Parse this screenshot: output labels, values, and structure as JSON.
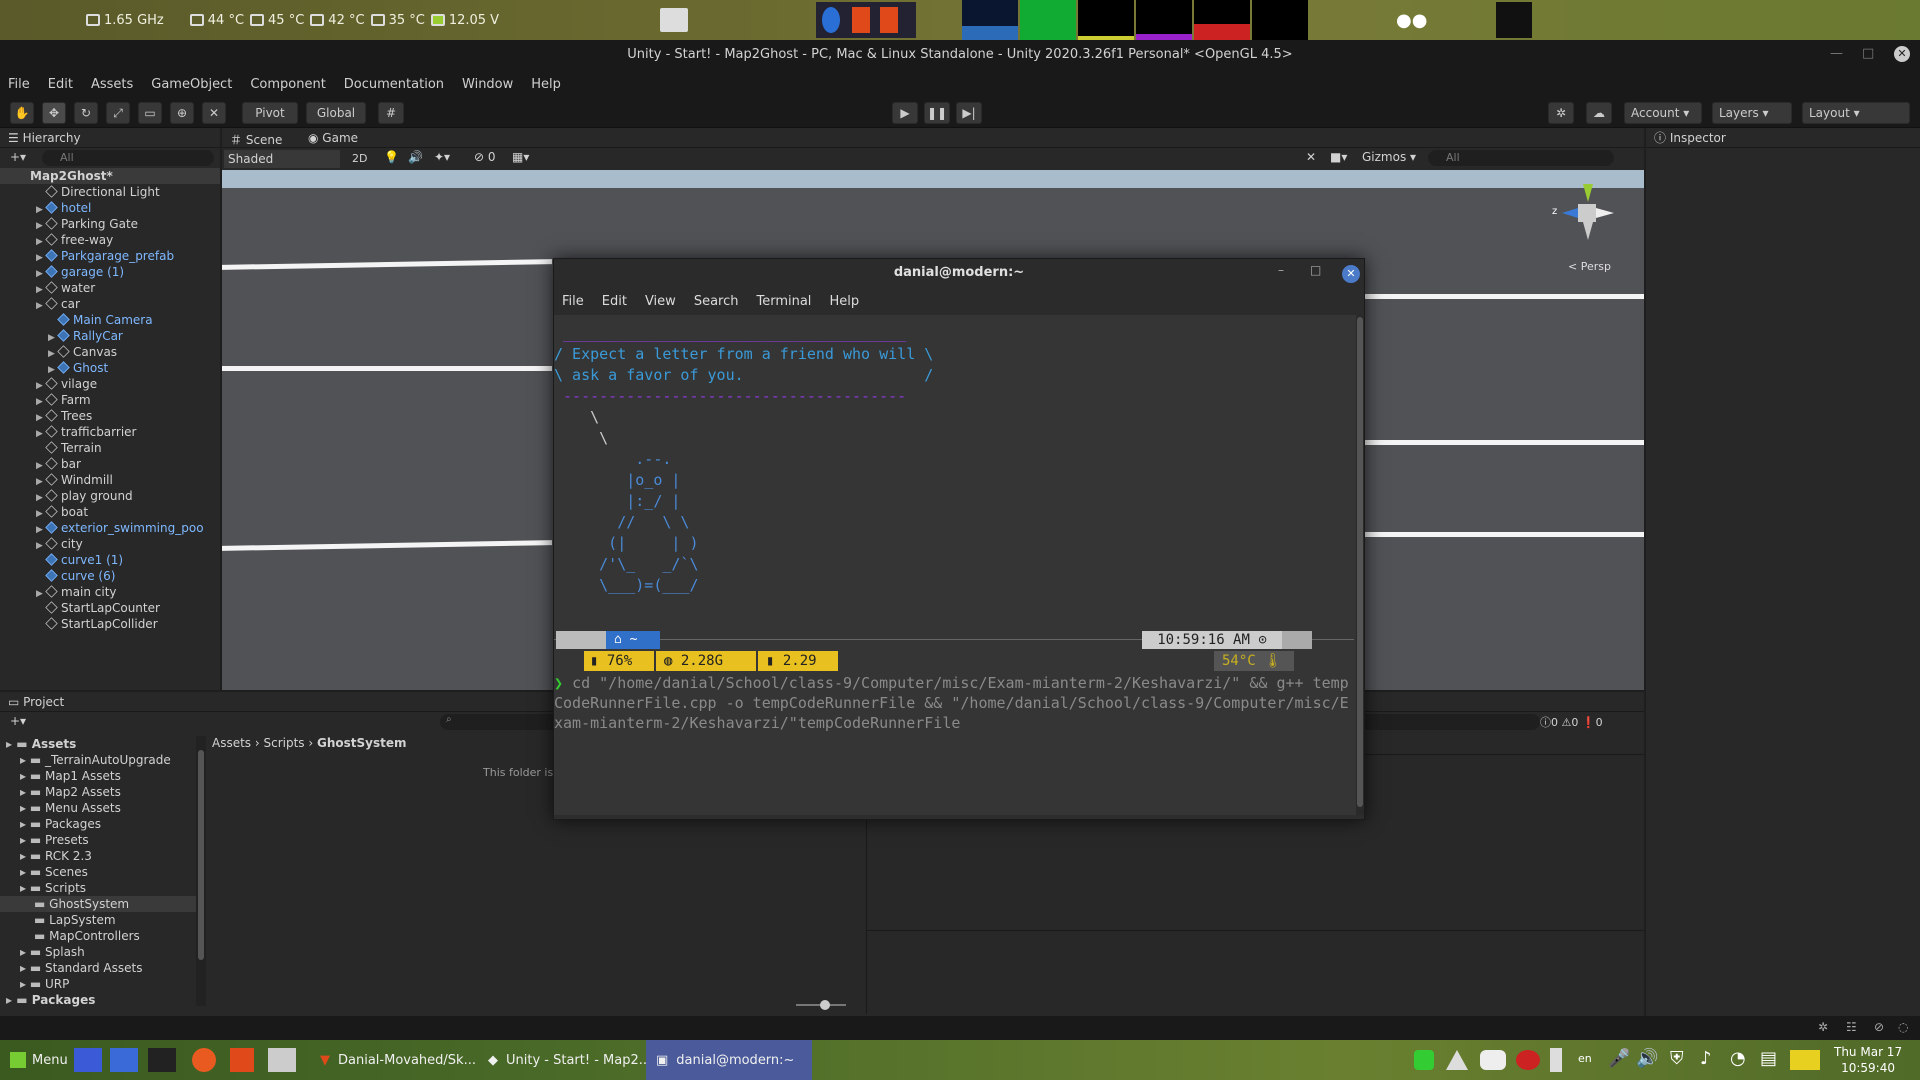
{
  "top_panel": {
    "cpu_freq": "1.65 GHz",
    "temps": [
      "44 °C",
      "45 °C",
      "42 °C",
      "35 °C"
    ],
    "voltage": "12.05 V"
  },
  "unity": {
    "title": "Unity - Start! - Map2Ghost - PC, Mac & Linux Standalone - Unity 2020.3.26f1 Personal* <OpenGL 4.5>",
    "menu": [
      "File",
      "Edit",
      "Assets",
      "GameObject",
      "Component",
      "Documentation",
      "Window",
      "Help"
    ],
    "toolbar": {
      "pivot": "Pivot",
      "global": "Global",
      "account": "Account",
      "layers": "Layers",
      "layout": "Layout"
    },
    "hierarchy": {
      "tab": "Hierarchy",
      "search_placeholder": "All",
      "scene": "Map2Ghost*",
      "items": [
        {
          "label": "Directional Light",
          "prefab": false,
          "indent": 1,
          "arrow": false
        },
        {
          "label": "hotel",
          "prefab": true,
          "indent": 1,
          "arrow": true
        },
        {
          "label": "Parking Gate",
          "prefab": false,
          "indent": 1,
          "arrow": true
        },
        {
          "label": "free-way",
          "prefab": false,
          "indent": 1,
          "arrow": true
        },
        {
          "label": "Parkgarage_prefab",
          "prefab": true,
          "indent": 1,
          "arrow": true
        },
        {
          "label": "garage (1)",
          "prefab": true,
          "indent": 1,
          "arrow": true
        },
        {
          "label": "water",
          "prefab": false,
          "indent": 1,
          "arrow": true
        },
        {
          "label": "car",
          "prefab": false,
          "indent": 1,
          "arrow": true
        },
        {
          "label": "Main Camera",
          "prefab": true,
          "indent": 2,
          "arrow": false
        },
        {
          "label": "RallyCar",
          "prefab": true,
          "indent": 2,
          "arrow": true
        },
        {
          "label": "Canvas",
          "prefab": false,
          "indent": 2,
          "arrow": true
        },
        {
          "label": "Ghost",
          "prefab": true,
          "indent": 2,
          "arrow": true
        },
        {
          "label": "vilage",
          "prefab": false,
          "indent": 1,
          "arrow": true
        },
        {
          "label": "Farm",
          "prefab": false,
          "indent": 1,
          "arrow": true
        },
        {
          "label": "Trees",
          "prefab": false,
          "indent": 1,
          "arrow": true
        },
        {
          "label": "trafficbarrier",
          "prefab": false,
          "indent": 1,
          "arrow": true
        },
        {
          "label": "Terrain",
          "prefab": false,
          "indent": 1,
          "arrow": false
        },
        {
          "label": "bar",
          "prefab": false,
          "indent": 1,
          "arrow": true
        },
        {
          "label": "Windmill",
          "prefab": false,
          "indent": 1,
          "arrow": true
        },
        {
          "label": "play ground",
          "prefab": false,
          "indent": 1,
          "arrow": true
        },
        {
          "label": "boat",
          "prefab": false,
          "indent": 1,
          "arrow": true
        },
        {
          "label": "exterior_swimming_poo",
          "prefab": true,
          "indent": 1,
          "arrow": true
        },
        {
          "label": "city",
          "prefab": false,
          "indent": 1,
          "arrow": true
        },
        {
          "label": "curve1 (1)",
          "prefab": true,
          "indent": 1,
          "arrow": false
        },
        {
          "label": "curve (6)",
          "prefab": true,
          "indent": 1,
          "arrow": false
        },
        {
          "label": "main city",
          "prefab": false,
          "indent": 1,
          "arrow": true
        },
        {
          "label": "StartLapCounter",
          "prefab": false,
          "indent": 1,
          "arrow": false
        },
        {
          "label": "StartLapCollider",
          "prefab": false,
          "indent": 1,
          "arrow": false
        }
      ]
    },
    "scene": {
      "tab_scene": "Scene",
      "tab_game": "Game",
      "shading": "Shaded",
      "mode_2d": "2D",
      "gizmos": "Gizmos",
      "search_placeholder": "All",
      "persp": "< Persp",
      "hidden_count": "0"
    },
    "inspector": {
      "tab": "Inspector"
    },
    "project": {
      "tab": "Project",
      "breadcrumb": [
        "Assets",
        "Scripts",
        "GhostSystem"
      ],
      "empty_msg": "This folder is",
      "counts": [
        "0",
        "0",
        "0"
      ],
      "tree": [
        {
          "label": "Assets",
          "indent": 0,
          "bold": true
        },
        {
          "label": "_TerrainAutoUpgrade",
          "indent": 1
        },
        {
          "label": "Map1 Assets",
          "indent": 1
        },
        {
          "label": "Map2 Assets",
          "indent": 1
        },
        {
          "label": "Menu Assets",
          "indent": 1
        },
        {
          "label": "Packages",
          "indent": 1
        },
        {
          "label": "Presets",
          "indent": 1
        },
        {
          "label": "RCK 2.3",
          "indent": 1
        },
        {
          "label": "Scenes",
          "indent": 1
        },
        {
          "label": "Scripts",
          "indent": 1
        },
        {
          "label": "GhostSystem",
          "indent": 2
        },
        {
          "label": "LapSystem",
          "indent": 2
        },
        {
          "label": "MapControllers",
          "indent": 2
        },
        {
          "label": "Splash",
          "indent": 1
        },
        {
          "label": "Standard Assets",
          "indent": 1
        },
        {
          "label": "URP",
          "indent": 1
        },
        {
          "label": "Packages",
          "indent": 0,
          "bold": true
        }
      ]
    }
  },
  "terminal": {
    "title": "danial@modern:~",
    "menu": [
      "File",
      "Edit",
      "View",
      "Search",
      "Terminal",
      "Help"
    ],
    "lines": [
      " ______________________________________",
      "/ Expect a letter from a friend who will \\",
      "\\ ask a favor of you.                    /",
      " --------------------------------------",
      "    \\",
      "     \\",
      "         .--.",
      "        |o_o |",
      "        |:_/ |",
      "       //   \\ \\",
      "      (|     | )",
      "     /'\\_   _/`\\",
      "     \\___)=(___/"
    ],
    "prompt": {
      "dir": "~",
      "time": "10:59:16 AM",
      "battery": "76%",
      "mem": "2.28G",
      "load": "2.29",
      "temp": "54°C",
      "command": "cd \"/home/danial/School/class-9/Computer/misc/Exam-mianterm-2/Keshavarzi/\" && g++ tempCodeRunnerFile.cpp -o tempCodeRunnerFile && \"/home/danial/School/class-9/Computer/misc/Exam-mianterm-2/Keshavarzi/\"tempCodeRunnerFile"
    }
  },
  "taskbar": {
    "menu": "Menu",
    "tasks": [
      "Danial-Movahed/Sk...",
      "Unity - Start! - Map2...",
      "danial@modern:~"
    ],
    "lang": "en",
    "date": "Thu Mar 17",
    "time": "10:59:40"
  }
}
